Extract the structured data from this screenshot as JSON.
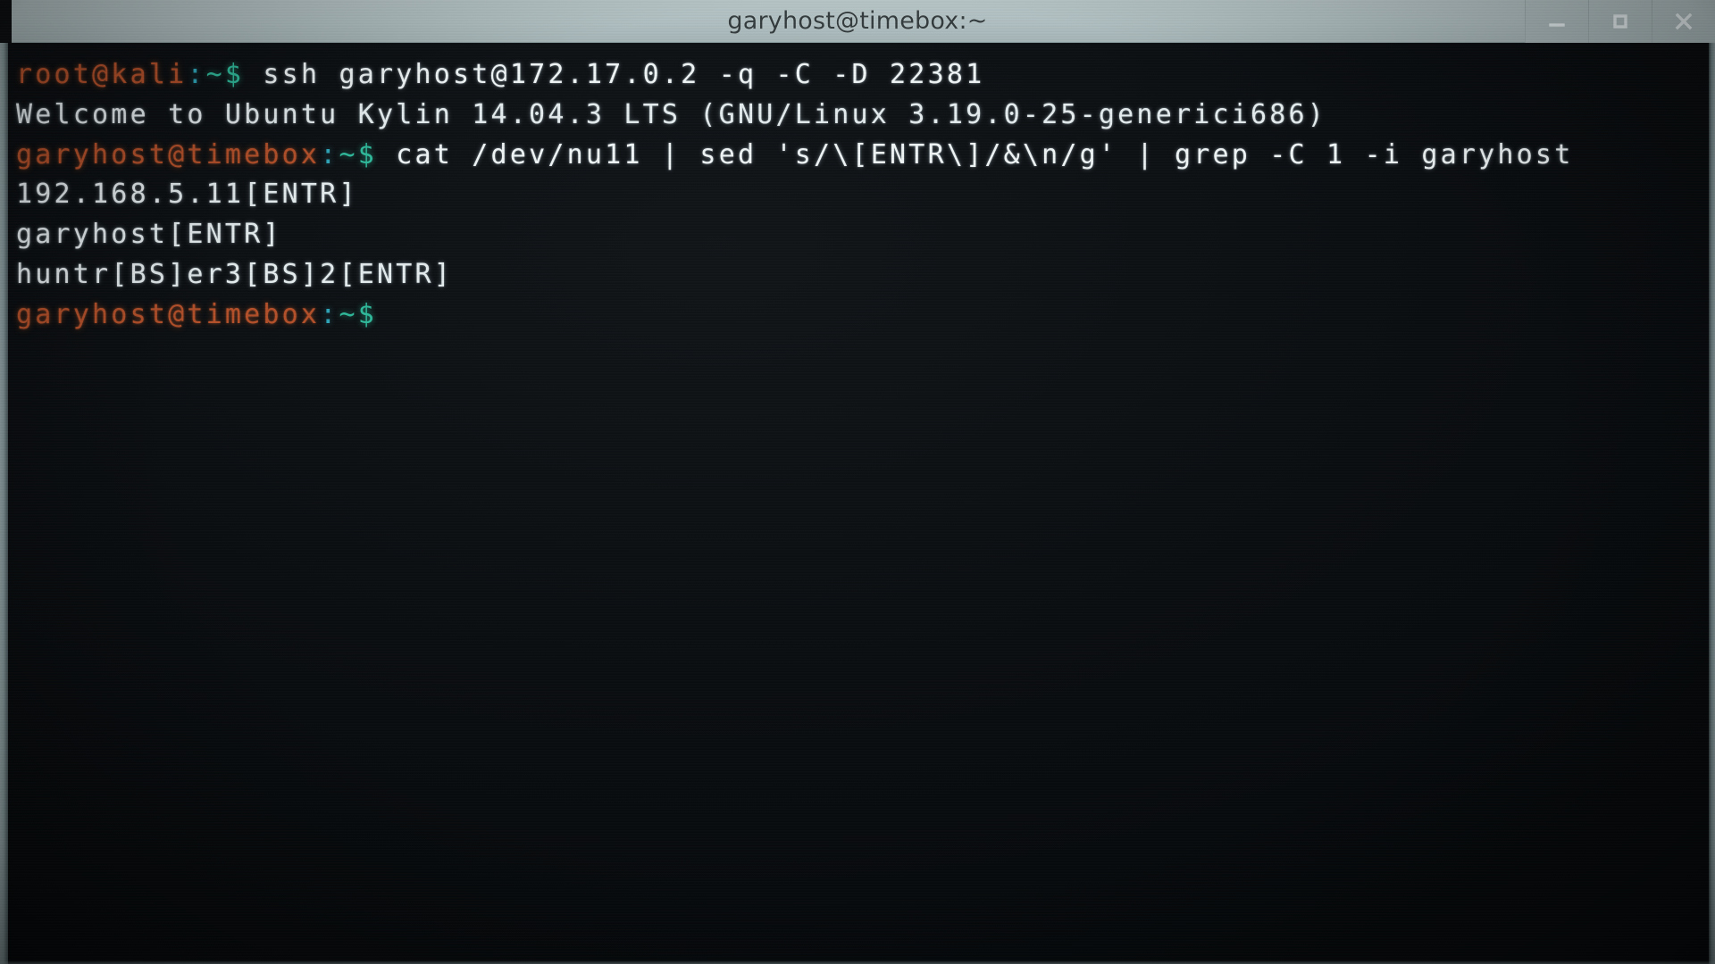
{
  "window": {
    "title": "garyhost@timebox:~",
    "controls": [
      {
        "name": "minimize",
        "glyph": "minimize-icon",
        "label": "Minimize"
      },
      {
        "name": "maximize",
        "glyph": "maximize-icon",
        "label": "Maximize"
      },
      {
        "name": "close",
        "glyph": "close-icon",
        "label": "Close"
      }
    ]
  },
  "theme": {
    "titlebar_bg": "#b0bfc1",
    "titlebar_fg": "#333b3d",
    "terminal_bg": "#0a0d10",
    "text_fg": "#e8eef0",
    "prompt_host": "#b4502a",
    "prompt_colon": "#2fa5b8",
    "prompt_tilde": "#2fb99a"
  },
  "terminal": {
    "lines": [
      {
        "type": "prompt",
        "host": "root@kali",
        "colon": ":",
        "tilde": "~$",
        "command": " ssh garyhost@172.17.0.2 -q -C -D 22381"
      },
      {
        "type": "output",
        "text": "Welcome to Ubuntu Kylin 14.04.3 LTS (GNU/Linux 3.19.0-25-generici686)"
      },
      {
        "type": "prompt",
        "host": "garyhost@timebox",
        "colon": ":",
        "tilde": "~$",
        "command": " cat /dev/nu11 | sed 's/\\[ENTR\\]/&\\n/g' | grep -C 1 -i garyhost"
      },
      {
        "type": "output",
        "text": "192.168.5.11[ENTR]"
      },
      {
        "type": "output",
        "text": "garyhost[ENTR]"
      },
      {
        "type": "output",
        "text": "huntr[BS]er3[BS]2[ENTR]"
      },
      {
        "type": "prompt",
        "host": "garyhost@timebox",
        "colon": ":",
        "tilde": "~$",
        "command": ""
      }
    ]
  }
}
